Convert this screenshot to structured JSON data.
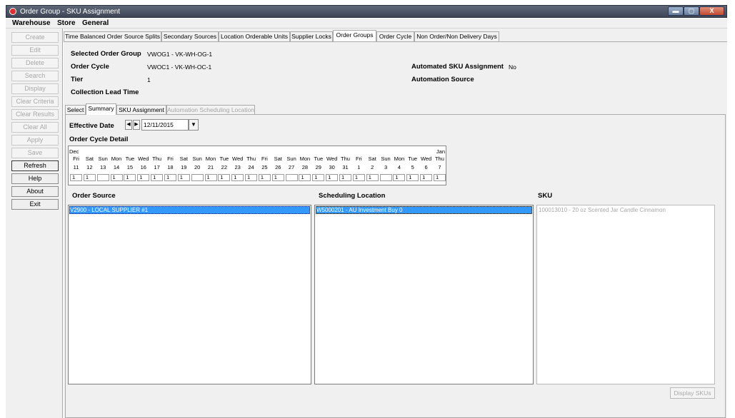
{
  "window": {
    "title": "Order Group - SKU Assignment",
    "min_glyph": "▬",
    "max_glyph": "▢",
    "close_glyph": "X"
  },
  "menu": [
    "Warehouse",
    "Store",
    "General"
  ],
  "toolbar": [
    {
      "label": "Create",
      "enabled": false
    },
    {
      "label": "Edit",
      "enabled": false
    },
    {
      "label": "Delete",
      "enabled": false
    },
    {
      "label": "Search",
      "enabled": false
    },
    {
      "label": "Display",
      "enabled": false
    },
    {
      "label": "Clear Criteria",
      "enabled": false
    },
    {
      "label": "Clear Results",
      "enabled": false
    },
    {
      "label": "Clear All",
      "enabled": false
    },
    {
      "label": "Apply",
      "enabled": false
    },
    {
      "label": "Save",
      "enabled": false
    },
    {
      "label": "Refresh",
      "enabled": true
    },
    {
      "label": "Help",
      "enabled": true
    },
    {
      "label": "About",
      "enabled": true
    },
    {
      "label": "Exit",
      "enabled": true
    }
  ],
  "tabs": [
    "Time Balanced Order Source Splits",
    "Secondary Sources",
    "Location Orderable Units",
    "Supplier Locks",
    "Order Groups",
    "Order Cycle",
    "Non Order/Non Delivery Days"
  ],
  "active_tab": "Order Groups",
  "header": {
    "selected_order_group_label": "Selected Order Group",
    "selected_order_group_value": "VWOG1 - VK-WH-OG-1",
    "order_cycle_label": "Order Cycle",
    "order_cycle_value": "VWOC1 - VK-WH-OC-1",
    "tier_label": "Tier",
    "tier_value": "1",
    "collection_lead_time_label": "Collection Lead Time",
    "automated_sku_label": "Automated SKU Assignment",
    "automated_sku_value": "No",
    "automation_source_label": "Automation Source"
  },
  "subtabs": [
    {
      "label": "Select",
      "active": false,
      "enabled": true
    },
    {
      "label": "Summary",
      "active": true,
      "enabled": true
    },
    {
      "label": "SKU Assignment",
      "active": false,
      "enabled": true
    },
    {
      "label": "Automation Scheduling Location",
      "active": false,
      "enabled": false
    }
  ],
  "effective_date": {
    "label": "Effective Date",
    "value": "12/11/2015",
    "prev_glyph": "◀",
    "next_glyph": "▶",
    "dropdown_glyph": "▼"
  },
  "cycle_detail": {
    "label": "Order Cycle Detail",
    "month_start": "Dec",
    "month_end": "Jan",
    "days": [
      {
        "dow": "Fri",
        "date": "11",
        "val": "1"
      },
      {
        "dow": "Sat",
        "date": "12",
        "val": "1"
      },
      {
        "dow": "Sun",
        "date": "13",
        "val": ""
      },
      {
        "dow": "Mon",
        "date": "14",
        "val": "1"
      },
      {
        "dow": "Tue",
        "date": "15",
        "val": "1"
      },
      {
        "dow": "Wed",
        "date": "16",
        "val": "1"
      },
      {
        "dow": "Thu",
        "date": "17",
        "val": "1"
      },
      {
        "dow": "Fri",
        "date": "18",
        "val": "1"
      },
      {
        "dow": "Sat",
        "date": "19",
        "val": "1"
      },
      {
        "dow": "Sun",
        "date": "20",
        "val": ""
      },
      {
        "dow": "Mon",
        "date": "21",
        "val": "1"
      },
      {
        "dow": "Tue",
        "date": "22",
        "val": "1"
      },
      {
        "dow": "Wed",
        "date": "23",
        "val": "1"
      },
      {
        "dow": "Thu",
        "date": "24",
        "val": "1"
      },
      {
        "dow": "Fri",
        "date": "25",
        "val": "1"
      },
      {
        "dow": "Sat",
        "date": "26",
        "val": "1"
      },
      {
        "dow": "Sun",
        "date": "27",
        "val": ""
      },
      {
        "dow": "Mon",
        "date": "28",
        "val": "1"
      },
      {
        "dow": "Tue",
        "date": "29",
        "val": "1"
      },
      {
        "dow": "Wed",
        "date": "30",
        "val": "1"
      },
      {
        "dow": "Thu",
        "date": "31",
        "val": "1"
      },
      {
        "dow": "Fri",
        "date": "1",
        "val": "1"
      },
      {
        "dow": "Sat",
        "date": "2",
        "val": "1"
      },
      {
        "dow": "Sun",
        "date": "3",
        "val": ""
      },
      {
        "dow": "Mon",
        "date": "4",
        "val": "1"
      },
      {
        "dow": "Tue",
        "date": "5",
        "val": "1"
      },
      {
        "dow": "Wed",
        "date": "6",
        "val": "1"
      },
      {
        "dow": "Thu",
        "date": "7",
        "val": "1"
      }
    ]
  },
  "lists": {
    "order_source": {
      "label": "Order Source",
      "items": [
        "V2900 - LOCAL SUPPLIER #1"
      ]
    },
    "scheduling_location": {
      "label": "Scheduling Location",
      "items": [
        "W5000201 - AU Investment Buy 0"
      ]
    },
    "sku": {
      "label": "SKU",
      "items": [
        "100013010 - 20 oz Scented Jar Candle Cinnamon"
      ]
    }
  },
  "display_skus_button": "Display SKUs",
  "colors": {
    "selection": "#3399ff",
    "disabled_text": "#a8a8a8",
    "titlebar": "#4a5366"
  }
}
